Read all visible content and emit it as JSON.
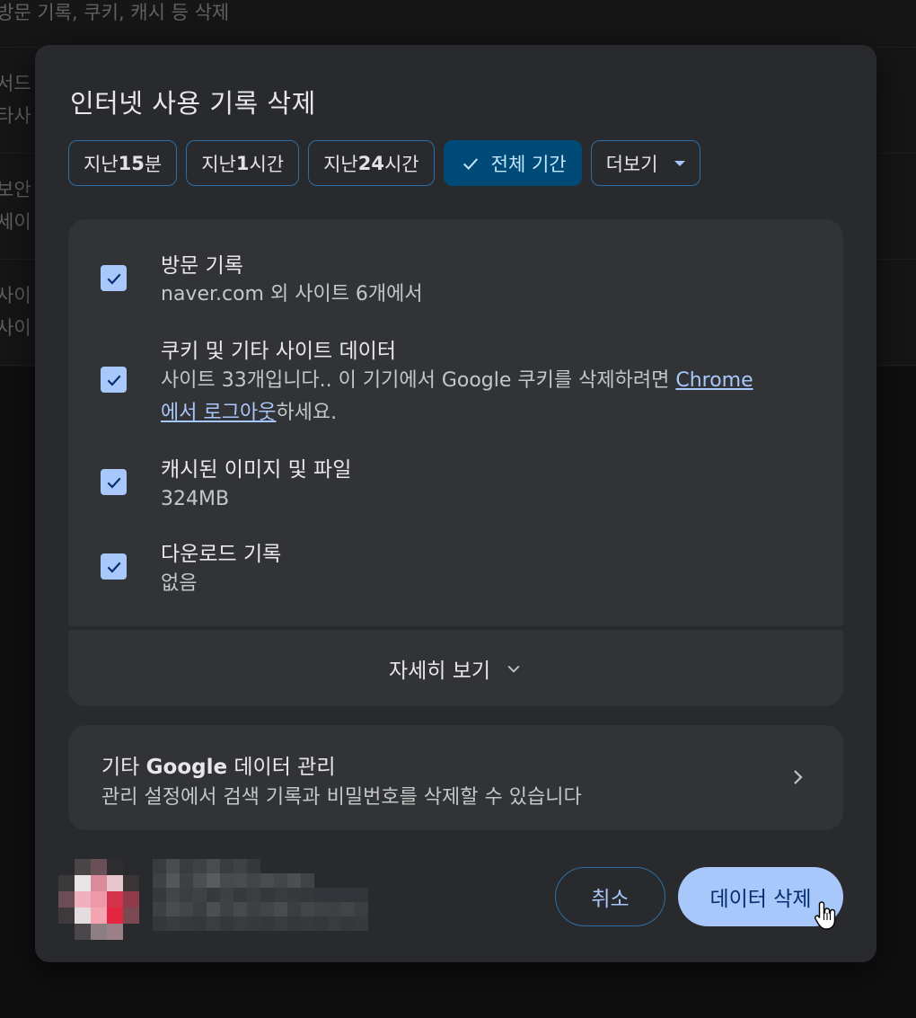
{
  "background": {
    "row1": "방문 기록, 쿠키, 캐시 등 삭제",
    "row2_l1": "서드",
    "row2_l2": "타사",
    "row3_l1": "보안",
    "row3_l2": "세이",
    "row4_l1": "사이",
    "row4_l2": "사이"
  },
  "dialog": {
    "title": "인터넷 사용 기록 삭제",
    "time_ranges": [
      {
        "prefix": "지난 ",
        "bold": "15",
        "suffix": "분",
        "selected": false
      },
      {
        "prefix": "지난 ",
        "bold": "1",
        "suffix": "시간",
        "selected": false
      },
      {
        "prefix": "지난 ",
        "bold": "24",
        "suffix": "시간",
        "selected": false
      },
      {
        "label": "전체 기간",
        "selected": true
      },
      {
        "label": "더보기",
        "dropdown": true
      }
    ],
    "options": [
      {
        "title": "방문 기록",
        "subtitle": "naver.com 외 사이트 6개에서",
        "checked": true
      },
      {
        "title": "쿠키 및 기타 사이트 데이터",
        "subtitle_before_link": "사이트 33개입니다.. 이 기기에서 Google 쿠키를 삭제하려면 ",
        "link_part1": "Chrome",
        "link_part2": "에서 로그아웃",
        "subtitle_after_link": "하세요.",
        "checked": true
      },
      {
        "title": "캐시된 이미지 및 파일",
        "subtitle": "324MB",
        "checked": true
      },
      {
        "title": "다운로드 기록",
        "subtitle": "없음",
        "checked": true
      }
    ],
    "show_more": "자세히 보기",
    "google_data": {
      "title_prefix": "기타 ",
      "title_bold": "Google",
      "title_suffix": " 데이터 관리",
      "subtitle": "관리 설정에서 검색 기록과 비밀번호를 삭제할 수 있습니다"
    },
    "cancel_label": "취소",
    "delete_label": "데이터 삭제"
  },
  "colors": {
    "dialog_bg": "#292a2d",
    "card_bg": "#323337",
    "accent": "#a8c7fa",
    "chip_border": "#2b6fa6",
    "chip_selected_bg": "#004a77"
  },
  "icons": {
    "checkmark": "check-icon",
    "dropdown": "caret-down-icon",
    "expand": "chevron-down-icon",
    "navigate": "chevron-right-icon",
    "pointer": "hand-cursor-icon"
  }
}
